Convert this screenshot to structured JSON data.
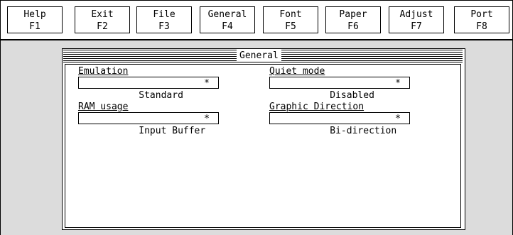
{
  "function_keys": [
    {
      "name": "Help",
      "key": "F1"
    },
    {
      "name": "Exit",
      "key": "F2"
    },
    {
      "name": "File",
      "key": "F3"
    },
    {
      "name": "General",
      "key": "F4"
    },
    {
      "name": "Font",
      "key": "F5"
    },
    {
      "name": "Paper",
      "key": "F6"
    },
    {
      "name": "Adjust",
      "key": "F7"
    },
    {
      "name": "Port",
      "key": "F8"
    }
  ],
  "dialog": {
    "title": "General",
    "fields": {
      "emulation": {
        "label": "Emulation",
        "value": "Standard",
        "marker": "*"
      },
      "quiet_mode": {
        "label": "Quiet mode",
        "value": "Disabled",
        "marker": "*"
      },
      "ram_usage": {
        "label": "RAM usage",
        "value": "Input Buffer",
        "marker": "*"
      },
      "graphic_direction": {
        "label": "Graphic Direction",
        "value": "Bi-direction",
        "marker": "*"
      }
    }
  },
  "colors": {
    "workspace_background": "#dcdcdc",
    "foreground": "#000000",
    "panel_background": "#ffffff"
  }
}
